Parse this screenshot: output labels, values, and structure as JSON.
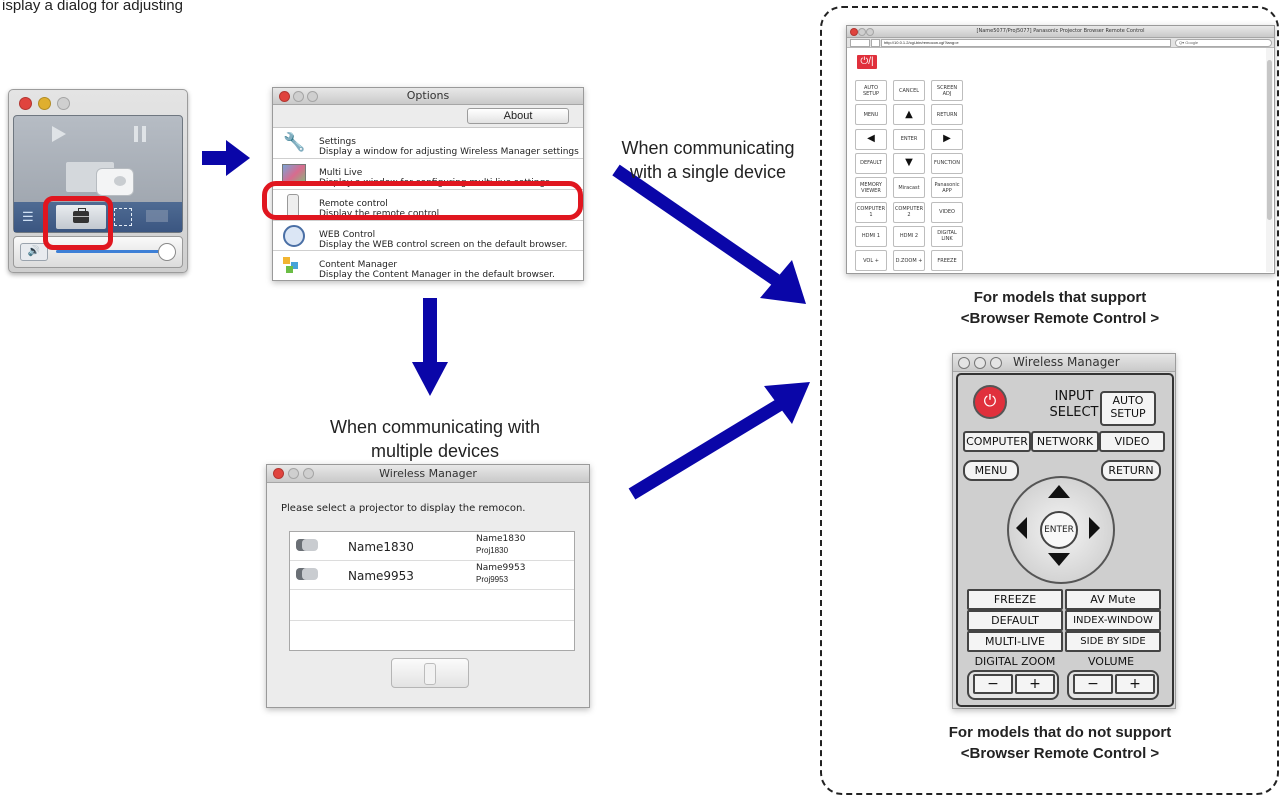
{
  "colors": {
    "arrow": "#0a06a8",
    "highlight": "#e0161f",
    "power_red": "#e0303c"
  },
  "top_left_partial_text": "isplay a dialog for adjusting",
  "captions": {
    "single_device": [
      "When communicating",
      "with a single device"
    ],
    "multiple_devices": [
      "When communicating with",
      "multiple devices"
    ],
    "browser_supported": [
      "For models that support",
      "<Browser Remote Control >"
    ],
    "browser_not_supported": [
      "For models that do not support",
      "<Browser Remote Control >"
    ]
  },
  "options_window": {
    "title": "Options",
    "about_button": "About",
    "items": [
      {
        "icon": "wrench-icon",
        "title": "Settings",
        "desc": "Display a window for adjusting Wireless Manager settings"
      },
      {
        "icon": "multi-live-icon",
        "title": "Multi Live",
        "desc": "Display a window for configuring multi live settings"
      },
      {
        "icon": "remote-icon",
        "title": "Remote control",
        "desc": "Display the remote control"
      },
      {
        "icon": "globe-icon",
        "title": "WEB Control",
        "desc": "Display the WEB control screen on the default browser."
      },
      {
        "icon": "content-manager-icon",
        "title": "Content Manager",
        "desc": "Display the Content Manager in the default browser."
      }
    ]
  },
  "wireless_dialog": {
    "title": "Wireless Manager",
    "prompt": "Please select a projector to display the remocon.",
    "projectors": [
      {
        "name": "Name1830",
        "detail_name": "Name1830",
        "detail_proj": "Proj1830"
      },
      {
        "name": "Name9953",
        "detail_name": "Name9953",
        "detail_proj": "Proj9953"
      }
    ]
  },
  "browser_window": {
    "title": "[Name5077/Proj5077] Panasonic Projector Browser Remote Control",
    "url": "http://10.0.1.2/cgi-bin/remocon.cgi?lang=e",
    "search_placeholder": "Q▾ Google",
    "power_label": "⏻/|",
    "buttons": [
      "AUTO SETUP",
      "CANCEL",
      "SCREEN ADJ",
      "MENU",
      "▲",
      "RETURN",
      "◀",
      "ENTER",
      "▶",
      "DEFAULT",
      "▼",
      "FUNCTION",
      "MEMORY VIEWER",
      "Miracast",
      "Panasonic APP",
      "COMPUTER 1",
      "COMPUTER 2",
      "VIDEO",
      "HDMI 1",
      "HDMI 2",
      "DIGITAL LINK",
      "VOL +",
      "D.ZOOM +",
      "FREEZE"
    ]
  },
  "remote_window": {
    "title": "Wireless Manager",
    "input_select": [
      "INPUT",
      "SELECT"
    ],
    "auto_setup": [
      "AUTO",
      "SETUP"
    ],
    "inputs": [
      "COMPUTER",
      "NETWORK",
      "VIDEO"
    ],
    "menu": "MENU",
    "return_label": "RETURN",
    "enter": "ENTER",
    "func_buttons": [
      [
        "FREEZE",
        "AV Mute"
      ],
      [
        "DEFAULT",
        "INDEX-WINDOW"
      ],
      [
        "MULTI-LIVE",
        "SIDE BY SIDE"
      ]
    ],
    "digital_zoom": "DIGITAL ZOOM",
    "volume": "VOLUME",
    "minus": "−",
    "plus": "+"
  }
}
